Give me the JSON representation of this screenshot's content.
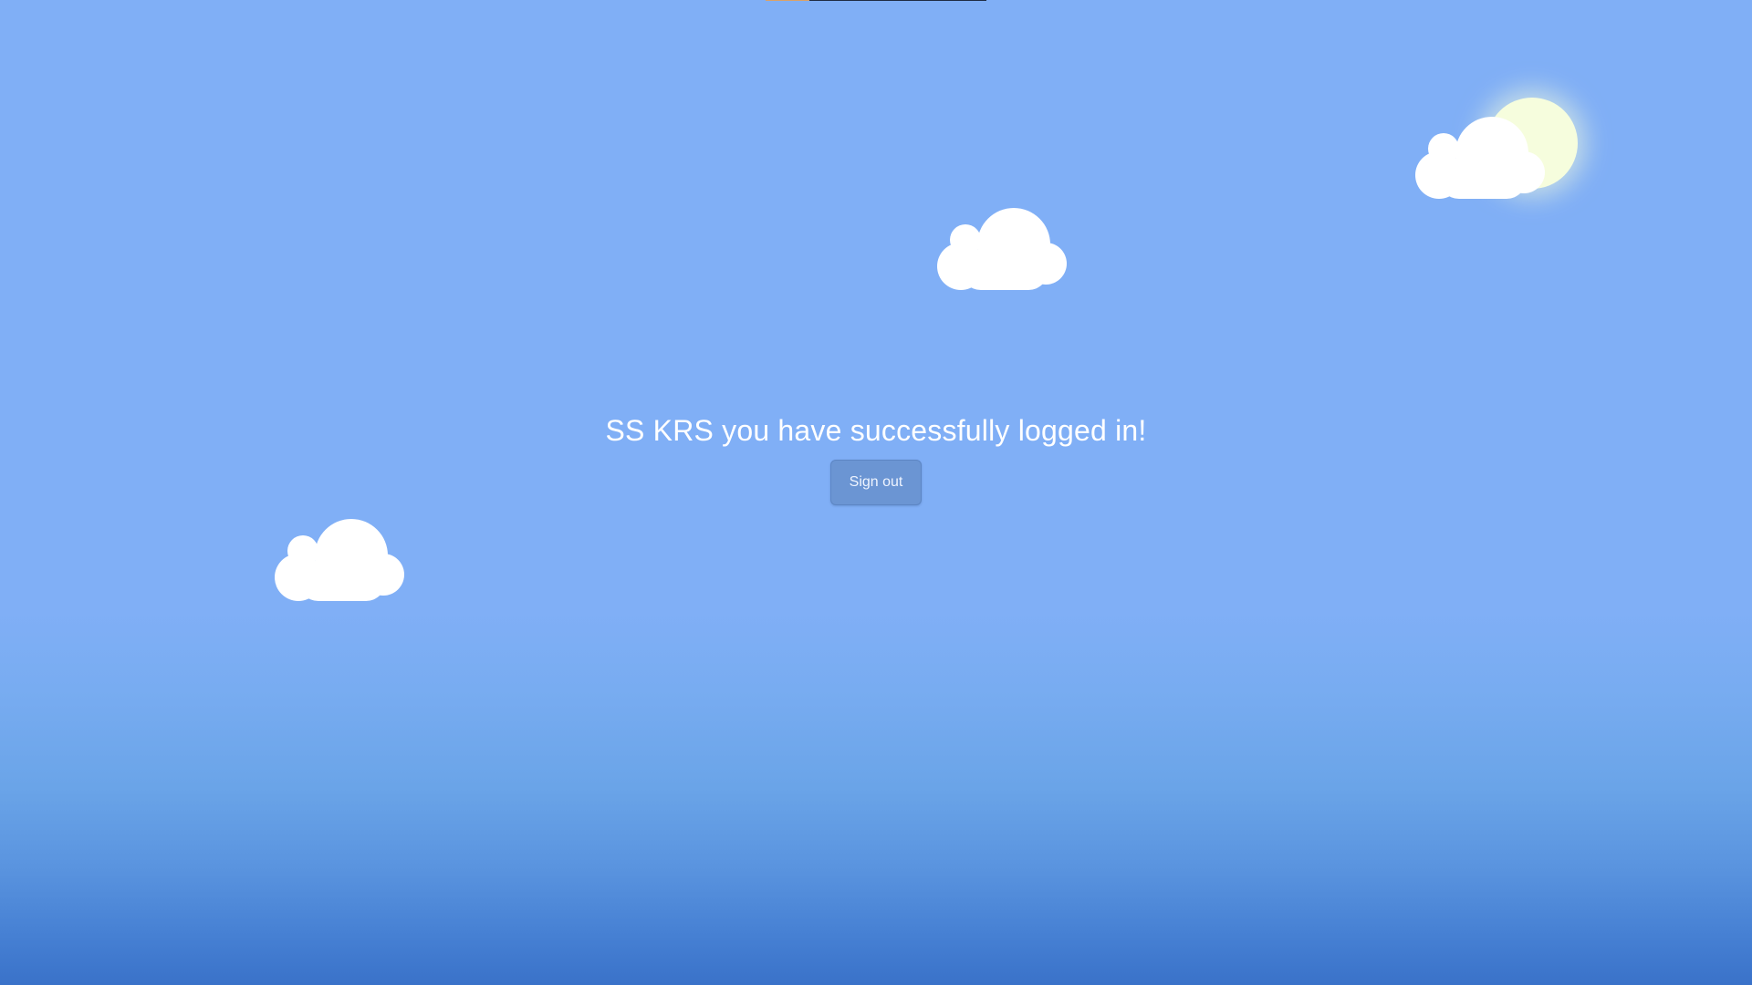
{
  "page": {
    "message": "SS KRS you have successfully logged in!",
    "signout_label": "Sign out"
  },
  "icons": {
    "sun": "sun-icon",
    "cloud": "cloud-icon"
  },
  "colors": {
    "sky_top": "#80aff6",
    "sky_bottom": "#3a72c9",
    "sun": "#f6fddd",
    "cloud": "#ffffff",
    "button": "#6b95d3",
    "text": "#ffffff"
  }
}
